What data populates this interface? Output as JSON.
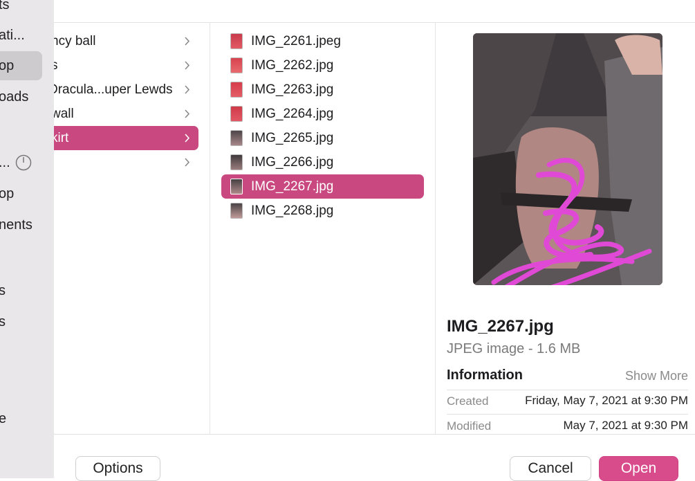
{
  "sidebar": {
    "items": [
      {
        "label": "ts"
      },
      {
        "label": "ati..."
      },
      {
        "label": "op"
      },
      {
        "label": "oads"
      },
      {
        "label": "..."
      },
      {
        "label": "op"
      },
      {
        "label": "nents"
      },
      {
        "label": "s"
      },
      {
        "label": "s"
      },
      {
        "label": "e"
      }
    ]
  },
  "column1": {
    "items": [
      {
        "label": "ncy ball"
      },
      {
        "label": "s"
      },
      {
        "label": "Dracula...uper Lewds"
      },
      {
        "label": " wall"
      },
      {
        "label": "kirt"
      },
      {
        "label": ""
      }
    ]
  },
  "column2": {
    "files": [
      {
        "name": "IMG_2261.jpeg"
      },
      {
        "name": "IMG_2262.jpg"
      },
      {
        "name": "IMG_2263.jpg"
      },
      {
        "name": "IMG_2264.jpg"
      },
      {
        "name": "IMG_2265.jpg"
      },
      {
        "name": "IMG_2266.jpg"
      },
      {
        "name": "IMG_2267.jpg"
      },
      {
        "name": "IMG_2268.jpg"
      }
    ]
  },
  "preview": {
    "title": "IMG_2267.jpg",
    "kind": "JPEG image - 1.6 MB",
    "info_heading": "Information",
    "show_more": "Show More",
    "created_label": "Created",
    "created_value": "Friday, May 7, 2021 at 9:30 PM",
    "modified_label": "Modified",
    "modified_value": "May 7, 2021 at 9:30 PM"
  },
  "buttons": {
    "options": "Options",
    "cancel": "Cancel",
    "open": "Open"
  },
  "colors": {
    "selection": "#c8487f",
    "open_button": "#d94c8c",
    "sidebar_bg": "#e9e7ea"
  }
}
